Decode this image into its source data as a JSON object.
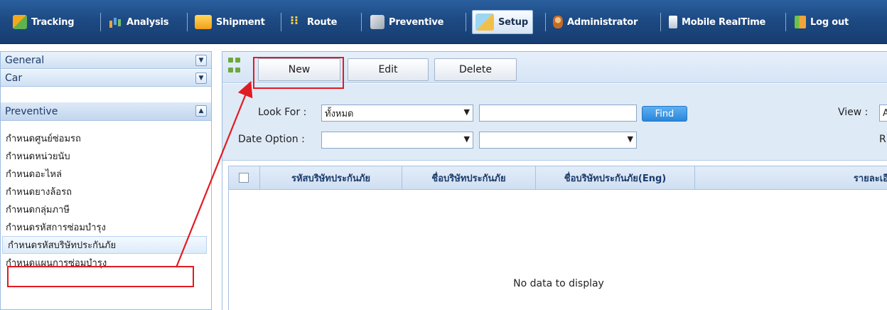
{
  "nav": {
    "items": [
      {
        "label": "Tracking",
        "icon": "tracking-icon"
      },
      {
        "label": "Analysis",
        "icon": "analysis-icon"
      },
      {
        "label": "Shipment",
        "icon": "shipment-icon"
      },
      {
        "label": "Route",
        "icon": "route-icon"
      },
      {
        "label": "Preventive",
        "icon": "preventive-icon"
      },
      {
        "label": "Setup",
        "icon": "setup-icon",
        "active": true
      },
      {
        "label": "Administrator",
        "icon": "administrator-icon"
      },
      {
        "label": "Mobile RealTime",
        "icon": "mobile-icon"
      },
      {
        "label": "Log out",
        "icon": "logout-icon"
      }
    ]
  },
  "sidebar": {
    "sections": [
      {
        "label": "General",
        "state": "collapsed"
      },
      {
        "label": "Car",
        "state": "collapsed"
      },
      {
        "label": "Preventive",
        "state": "expanded"
      }
    ],
    "items": [
      {
        "label": "กำหนดศูนย์ซ่อมรถ"
      },
      {
        "label": "กำหนดหน่วยนับ"
      },
      {
        "label": "กำหนดอะไหล่"
      },
      {
        "label": "กำหนดยางล้อรถ"
      },
      {
        "label": "กำหนดกลุ่มภาษี"
      },
      {
        "label": "กำหนดรหัสการซ่อมบำรุง"
      },
      {
        "label": "กำหนดรหัสบริษัทประกันภัย",
        "selected": true
      },
      {
        "label": "กำหนดแผนการซ่อมบำรุง"
      }
    ]
  },
  "toolbar": {
    "new_label": "New",
    "edit_label": "Edit",
    "delete_label": "Delete"
  },
  "filter": {
    "look_for_label": "Look For :",
    "look_for_value": "ทั้งหมด",
    "search_value": "",
    "find_label": "Find",
    "view_label": "View :",
    "view_value": "A",
    "date_option_label": "Date Option :",
    "date_option_value": "",
    "date_range_value": "",
    "right_cut_label": "R"
  },
  "grid": {
    "columns": [
      "รหัสบริษัทประกันภัย",
      "ชื่อบริษัทประกันภัย",
      "ชื่อบริษัทประกันภัย(Eng)",
      "รายละเอี"
    ],
    "empty_message": "No data to display"
  },
  "colors": {
    "nav_bg": "#1d4a83",
    "accent_blue": "#2a86db",
    "highlight_red": "#e11b22"
  }
}
